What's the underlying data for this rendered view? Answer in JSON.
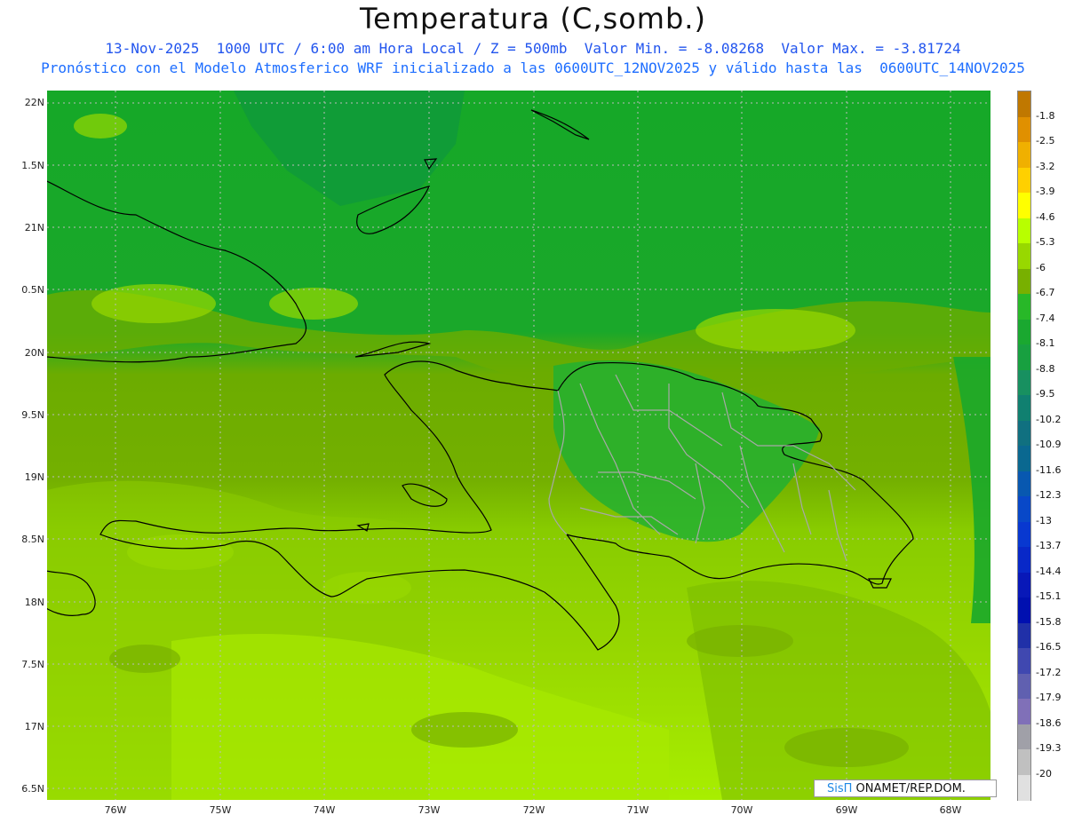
{
  "header": {
    "title": "Temperatura (C,somb.)",
    "line1": "13-Nov-2025  1000 UTC / 6:00 am Hora Local / Z = 500mb  Valor Min. = -8.08268  Valor Max. = -3.81724",
    "line2": "Pronóstico con el Modelo Atmosferico WRF inicializado a las 0600UTC_12NOV2025 y válido hasta las  0600UTC_14NOV2025"
  },
  "axes": {
    "lat_labels": [
      "22N",
      "1.5N",
      "21N",
      "0.5N",
      "20N",
      "9.5N",
      "19N",
      "8.5N",
      "18N",
      "7.5N",
      "17N",
      "6.5N"
    ],
    "lon_labels": [
      "76W",
      "75W",
      "74W",
      "73W",
      "72W",
      "71W",
      "70W",
      "69W",
      "68W"
    ]
  },
  "colorbar": {
    "labels": [
      "-1.8",
      "-2.5",
      "-3.2",
      "-3.9",
      "-4.6",
      "-5.3",
      "-6",
      "-6.7",
      "-7.4",
      "-8.1",
      "-8.8",
      "-9.5",
      "-10.2",
      "-10.9",
      "-11.6",
      "-12.3",
      "-13",
      "-13.7",
      "-14.4",
      "-15.1",
      "-15.8",
      "-16.5",
      "-17.2",
      "-17.9",
      "-18.6",
      "-19.3",
      "-20"
    ],
    "colors": [
      "#c07800",
      "#e09000",
      "#f0b000",
      "#ffd000",
      "#ffff00",
      "#b8ff00",
      "#98d800",
      "#78b000",
      "#28b828",
      "#1aa830",
      "#18a040",
      "#189060",
      "#108070",
      "#107080",
      "#0a6890",
      "#0858b0",
      "#0848c8",
      "#0838d0",
      "#0828c8",
      "#0818b8",
      "#0010b0",
      "#2030a8",
      "#4048b0",
      "#6060b0",
      "#8070b8",
      "#a0a0a8",
      "#c0c0c0",
      "#e0e0e0"
    ]
  },
  "credit": {
    "brand": "SisΠ",
    "text": " ONAMET/REP.DOM."
  }
}
